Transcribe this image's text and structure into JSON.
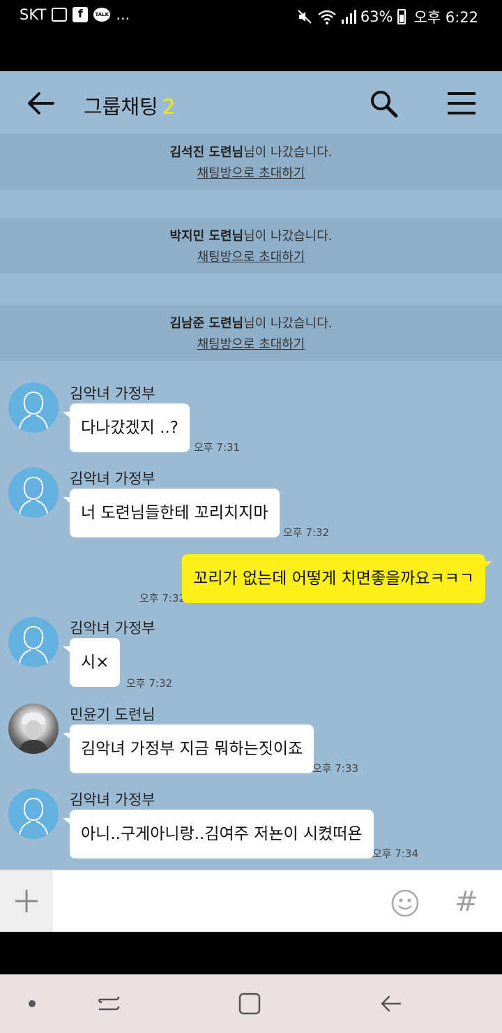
{
  "status_bar": {
    "carrier": "SKT",
    "more": "...",
    "battery": "63%",
    "battery_level": 0.63,
    "time": "오후 6:22",
    "icons": [
      "image-icon",
      "facebook-icon",
      "kakaotalk-icon",
      "mute-icon",
      "wifi-icon",
      "signal-icon",
      "battery-icon"
    ]
  },
  "header": {
    "title": "그룹채팅",
    "member_count": "2"
  },
  "notices": [
    {
      "name": "김석진 도련님",
      "suffix": "님이 나갔습니다.",
      "invite": "채팅방으로 초대하기"
    },
    {
      "name": "박지민 도련님",
      "suffix": "님이 나갔습니다.",
      "invite": "채팅방으로 초대하기"
    },
    {
      "name": "김남준 도련님",
      "suffix": "님이 나갔습니다.",
      "invite": "채팅방으로 초대하기"
    }
  ],
  "messages": [
    {
      "sender": "김악녀 가정부",
      "text": "다나갔겠지 ..?",
      "time": "오후 7:31",
      "mine": false
    },
    {
      "sender": "김악녀 가정부",
      "text": "너  도련님들한테 꼬리치지마",
      "time": "오후 7:32",
      "mine": false
    },
    {
      "sender": "",
      "text": "꼬리가 없는데 어떻게 치면좋을까요ㅋㅋㄱ",
      "time": "오후 7:32",
      "mine": true
    },
    {
      "sender": "김악녀 가정부",
      "text": "시×",
      "time": "오후 7:32",
      "mine": false
    },
    {
      "sender": "민윤기 도련님",
      "text": "김악녀 가정부 지금 뭐하는짓이죠",
      "time": "오후 7:33",
      "mine": false
    },
    {
      "sender": "김악녀 가정부",
      "text": "아니..구게아니랑..김여주 저뇬이 시켰떠욘",
      "time": "오후 7:34",
      "mine": false
    }
  ],
  "input": {
    "value": "",
    "placeholder": "",
    "hash": "#"
  },
  "colors": {
    "chat_background": "#9bbbd4",
    "my_bubble": "#fef01b",
    "member_count": "#f5e600",
    "avatar_default": "#64b0df"
  }
}
